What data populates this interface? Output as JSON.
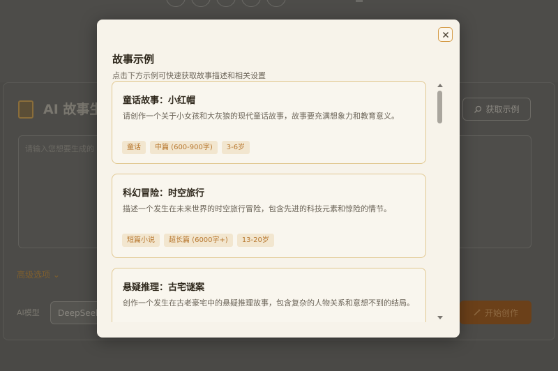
{
  "background": {
    "app_title": "AI 故事生",
    "fetch_examples_label": "获取示例",
    "textarea_placeholder": "请输入您想要生成的",
    "advanced_options_label": "高级选项",
    "model_label": "AI模型",
    "model_value": "DeepSeek",
    "start_button_label": "开始创作"
  },
  "modal": {
    "title": "故事示例",
    "subtitle": "点击下方示例可快速获取故事描述和相关设置",
    "close_icon": "close-icon",
    "examples": [
      {
        "title": "童话故事：小红帽",
        "description": "请创作一个关于小女孩和大灰狼的现代童话故事，故事要充满想象力和教育意义。",
        "tags": [
          "童话",
          "中篇 (600-900字)",
          "3-6岁"
        ]
      },
      {
        "title": "科幻冒险：时空旅行",
        "description": "描述一个发生在未来世界的时空旅行冒险，包含先进的科技元素和惊险的情节。",
        "tags": [
          "短篇小说",
          "超长篇 (6000字+)",
          "13-20岁"
        ]
      },
      {
        "title": "悬疑推理：古宅谜案",
        "description": "创作一个发生在古老豪宅中的悬疑推理故事，包含复杂的人物关系和意想不到的结局。",
        "tags": []
      }
    ]
  },
  "colors": {
    "accent": "#d49a45",
    "tag_text": "#b8782f",
    "tag_bg": "#f2e6cf",
    "card_border": "#e1c891"
  }
}
